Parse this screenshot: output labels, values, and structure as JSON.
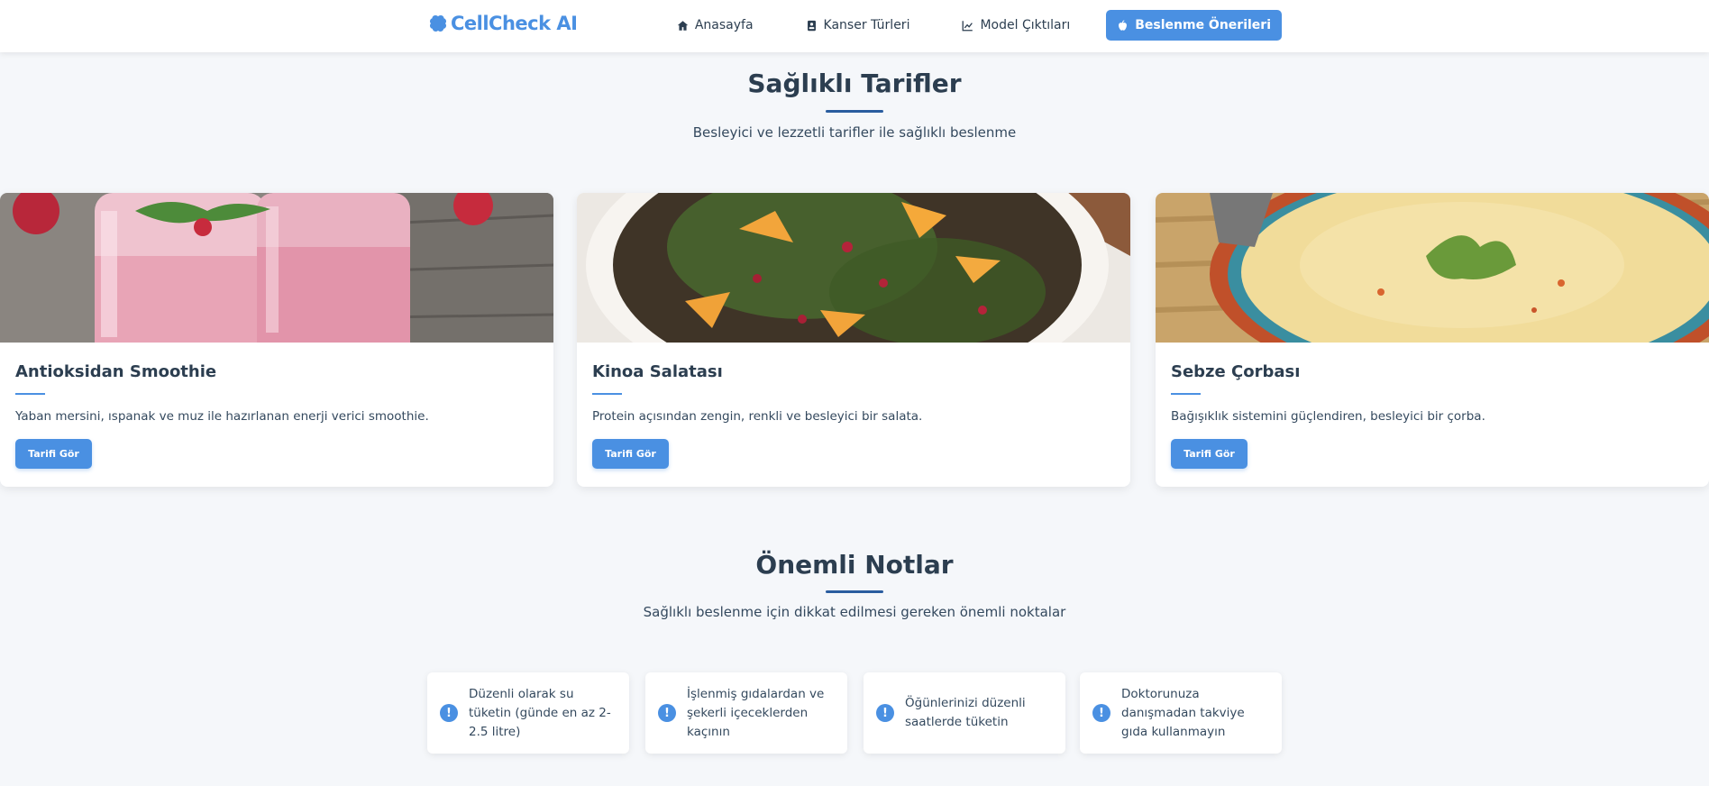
{
  "header": {
    "logo_text": "CellCheck AI",
    "nav": [
      {
        "label": "Anasayfa",
        "icon": "home-icon"
      },
      {
        "label": "Kanser Türleri",
        "icon": "book-icon"
      },
      {
        "label": "Model Çıktıları",
        "icon": "chart-line-icon"
      },
      {
        "label": "Beslenme Önerileri",
        "icon": "apple-icon",
        "active": true
      }
    ]
  },
  "recipes_section": {
    "title": "Sağlıklı Tarifler",
    "subtitle": "Besleyici ve lezzetli tarifler ile sağlıklı beslenme",
    "cards": [
      {
        "title": "Antioksidan Smoothie",
        "description": "Yaban mersini, ıspanak ve muz ile hazırlanan enerji verici smoothie.",
        "button": "Tarifi Gör"
      },
      {
        "title": "Kinoa Salatası",
        "description": "Protein açısından zengin, renkli ve besleyici bir salata.",
        "button": "Tarifi Gör"
      },
      {
        "title": "Sebze Çorbası",
        "description": "Bağışıklık sistemini güçlendiren, besleyici bir çorba.",
        "button": "Tarifi Gör"
      }
    ]
  },
  "notes_section": {
    "title": "Önemli Notlar",
    "subtitle": "Sağlıklı beslenme için dikkat edilmesi gereken önemli noktalar",
    "icon_glyph": "!",
    "notes": [
      "Düzenli olarak su tüketin (günde en az 2-2.5 litre)",
      "İşlenmiş gıdalardan ve şekerli içeceklerden kaçının",
      "Öğünlerinizi düzenli saatlerde tüketin",
      "Doktorunuza danışmadan takviye gıda kullanmayın"
    ]
  },
  "colors": {
    "accent": "#4a90e2",
    "title": "#2c3e50",
    "underline": "#2a5d9f",
    "background": "#f5f7fa"
  }
}
